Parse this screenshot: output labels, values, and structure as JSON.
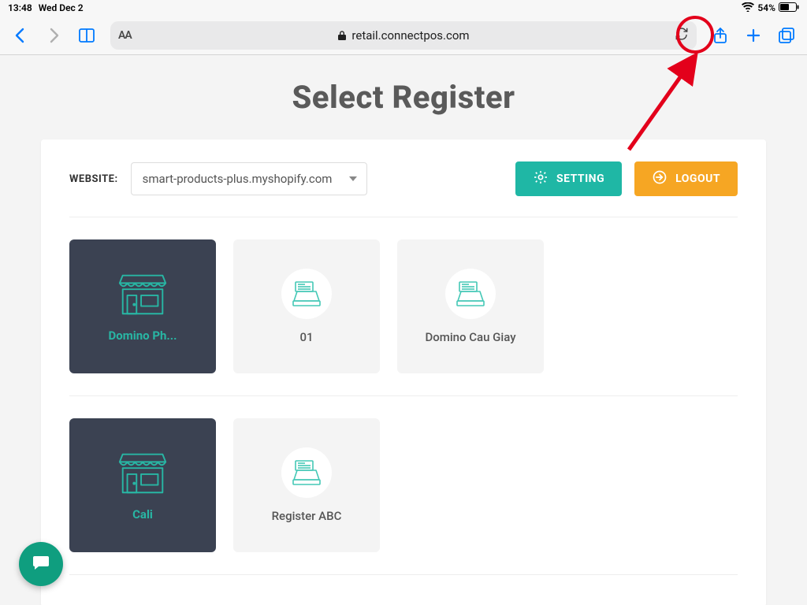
{
  "status": {
    "time": "13:48",
    "date": "Wed Dec 2",
    "battery_pct": "54%"
  },
  "toolbar": {
    "url_host": "retail.connectpos.com",
    "aa_label": "AA"
  },
  "page": {
    "title": "Select Register",
    "website_label": "WEBSITE:",
    "website_value": "smart-products-plus.myshopify.com",
    "setting_label": "SETTING",
    "logout_label": "LOGOUT"
  },
  "groups": [
    {
      "store": "Domino Ph...",
      "registers": [
        {
          "name": "01"
        },
        {
          "name": "Domino Cau Giay"
        }
      ]
    },
    {
      "store": "Cali",
      "registers": [
        {
          "name": "Register ABC"
        }
      ]
    }
  ]
}
